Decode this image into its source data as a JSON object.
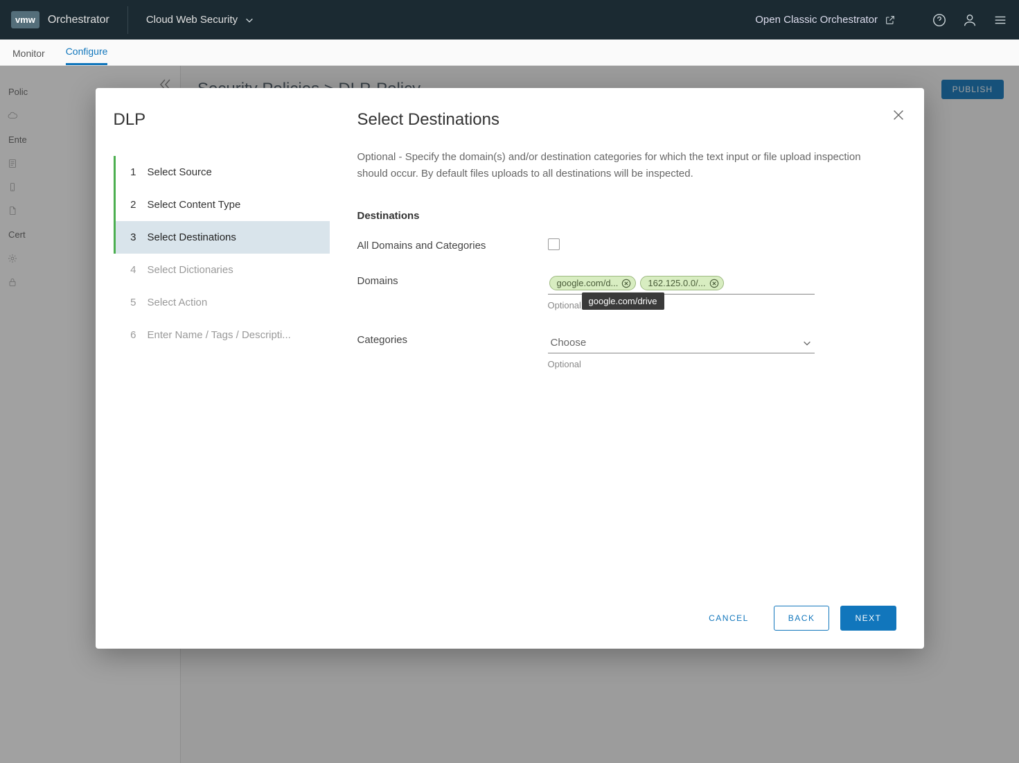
{
  "header": {
    "logo": "vmw",
    "product": "Orchestrator",
    "context": "Cloud Web Security",
    "classic_link": "Open Classic Orchestrator"
  },
  "tabs": {
    "monitor": "Monitor",
    "configure": "Configure"
  },
  "sidebar": {
    "groups": [
      "Polic",
      "Ente",
      "Cert"
    ]
  },
  "breadcrumb": {
    "root": "Security Policies",
    "sep": ">",
    "leaf": "DLP-Policy"
  },
  "publish": "PUBLISH",
  "wizard": {
    "title": "DLP",
    "steps": [
      {
        "num": "1",
        "label": "Select Source"
      },
      {
        "num": "2",
        "label": "Select Content Type"
      },
      {
        "num": "3",
        "label": "Select Destinations"
      },
      {
        "num": "4",
        "label": "Select Dictionaries"
      },
      {
        "num": "5",
        "label": "Select Action"
      },
      {
        "num": "6",
        "label": "Enter Name / Tags / Descripti..."
      }
    ]
  },
  "panel": {
    "title": "Select Destinations",
    "description": "Optional - Specify the domain(s) and/or destination categories for which the text input or file upload inspection should occur. By default files uploads to all destinations will be inspected.",
    "section": "Destinations",
    "rows": {
      "all": {
        "label": "All Domains and Categories"
      },
      "domains": {
        "label": "Domains",
        "chips": [
          "google.com/d...",
          "162.125.0.0/..."
        ],
        "hint": "Optional",
        "tooltip": "google.com/drive"
      },
      "categories": {
        "label": "Categories",
        "placeholder": "Choose",
        "hint": "Optional"
      }
    }
  },
  "buttons": {
    "cancel": "CANCEL",
    "back": "BACK",
    "next": "NEXT"
  }
}
